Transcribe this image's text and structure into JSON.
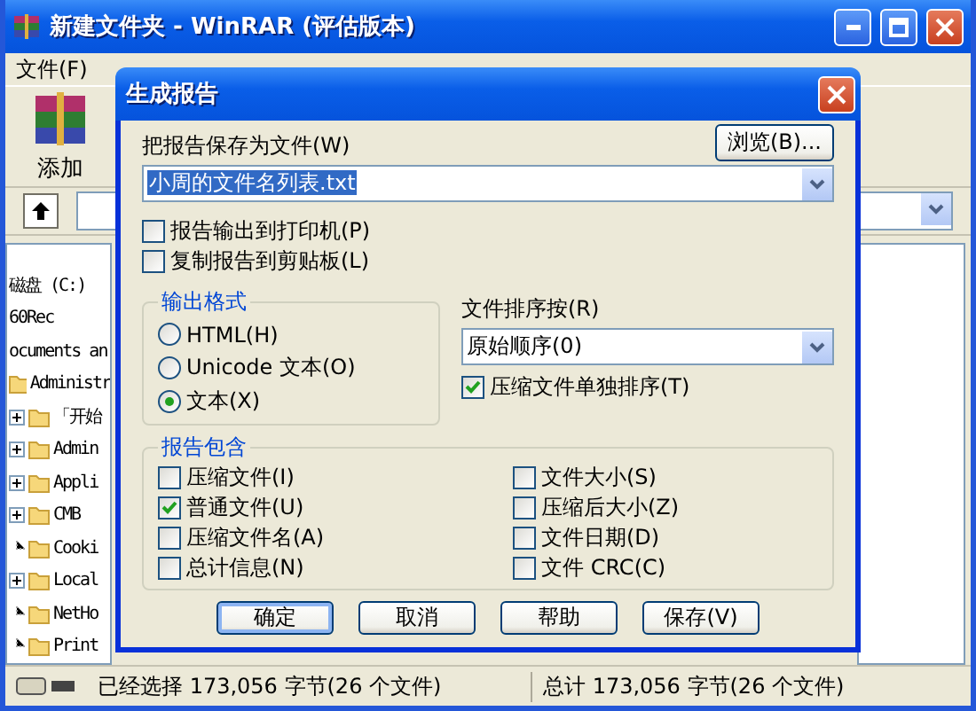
{
  "window": {
    "title": "新建文件夹 - WinRAR (评估版本)"
  },
  "menu": [
    {
      "label": "文件(F)"
    }
  ],
  "toolbar": [
    {
      "label": "添加"
    }
  ],
  "tree": [
    {
      "label": "磁盘 (C:)"
    },
    {
      "label": "60Rec"
    },
    {
      "label": "ocuments an",
      "children": [
        {
          "label": "Administr",
          "children": [
            {
              "label": "「开始",
              "expandable": true
            },
            {
              "label": "Admin",
              "expandable": true
            },
            {
              "label": "Appli",
              "expandable": true
            },
            {
              "label": "CMB",
              "expandable": true
            },
            {
              "label": "Cooki",
              "expandable": false
            },
            {
              "label": "Local",
              "expandable": true
            },
            {
              "label": "NetHo",
              "expandable": false
            },
            {
              "label": "Print",
              "expandable": false
            }
          ]
        }
      ]
    }
  ],
  "dialog": {
    "title": "生成报告",
    "save_label": "把报告保存为文件(W)",
    "browse": "浏览(B)...",
    "file_value": "小周的文件名列表.txt",
    "options": [
      {
        "label": "报告输出到打印机(P)",
        "checked": false
      },
      {
        "label": "复制报告到剪贴板(L)",
        "checked": false
      }
    ],
    "output_format": {
      "title": "输出格式",
      "options": [
        {
          "label": "HTML(H)",
          "selected": false
        },
        {
          "label": "Unicode 文本(O)",
          "selected": false
        },
        {
          "label": "文本(X)",
          "selected": true
        }
      ]
    },
    "sort": {
      "label": "文件排序按(R)",
      "value": "原始顺序(0)",
      "separate": {
        "label": "压缩文件单独排序(T)",
        "checked": true
      }
    },
    "include": {
      "title": "报告包含",
      "items": [
        {
          "label": "压缩文件(I)",
          "checked": false
        },
        {
          "label": "普通文件(U)",
          "checked": true
        },
        {
          "label": "压缩文件名(A)",
          "checked": false
        },
        {
          "label": "总计信息(N)",
          "checked": false
        },
        {
          "label": "文件大小(S)",
          "checked": false
        },
        {
          "label": "压缩后大小(Z)",
          "checked": false
        },
        {
          "label": "文件日期(D)",
          "checked": false
        },
        {
          "label": "文件 CRC(C)",
          "checked": false
        }
      ]
    },
    "buttons": [
      {
        "label": "确定",
        "default": true
      },
      {
        "label": "取消",
        "default": false
      },
      {
        "label": "帮助",
        "default": false
      },
      {
        "label": "保存(V)",
        "default": false
      }
    ]
  },
  "status_bar": [
    "已经选择 173,056 字节(26 个文件)",
    "总计 173,056 字节(26 个文件)"
  ]
}
